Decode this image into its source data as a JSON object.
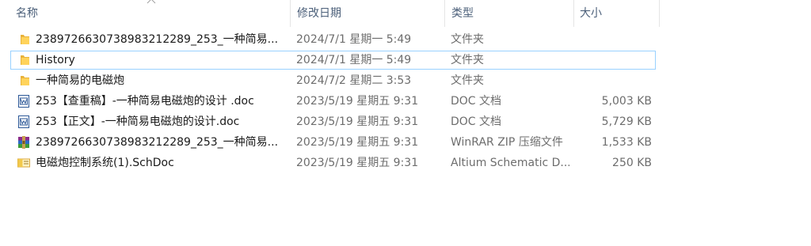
{
  "columns": {
    "name": "名称",
    "date": "修改日期",
    "type": "类型",
    "size": "大小"
  },
  "files": [
    {
      "icon": "folder-icon",
      "name": "2389726630738983212289_253_一种简易...",
      "date": "2024/7/1 星期一 5:49",
      "type": "文件夹",
      "size": ""
    },
    {
      "icon": "folder-icon",
      "name": "History",
      "date": "2024/7/1 星期一 5:49",
      "type": "文件夹",
      "size": ""
    },
    {
      "icon": "folder-icon",
      "name": "一种简易的电磁炮",
      "date": "2024/7/2 星期二 3:53",
      "type": "文件夹",
      "size": ""
    },
    {
      "icon": "word-doc-icon",
      "name": "253【查重稿】-一种简易电磁炮的设计 .doc",
      "date": "2023/5/19 星期五 9:31",
      "type": "DOC 文档",
      "size": "5,003 KB"
    },
    {
      "icon": "word-doc-icon",
      "name": "253【正文】-一种简易电磁炮的设计.doc",
      "date": "2023/5/19 星期五 9:31",
      "type": "DOC 文档",
      "size": "5,729 KB"
    },
    {
      "icon": "winrar-zip-icon",
      "name": "2389726630738983212289_253_一种简易...",
      "date": "2023/5/19 星期五 9:31",
      "type": "WinRAR ZIP 压缩文件",
      "size": "1,533 KB"
    },
    {
      "icon": "schdoc-file-icon",
      "name": "电磁炮控制系统(1).SchDoc",
      "date": "2023/5/19 星期五 9:31",
      "type": "Altium Schematic D...",
      "size": "250 KB"
    }
  ],
  "colors": {
    "header_text": "#4c607a",
    "selection_border": "#99d1ff",
    "secondary_text": "#6d6d6d"
  }
}
